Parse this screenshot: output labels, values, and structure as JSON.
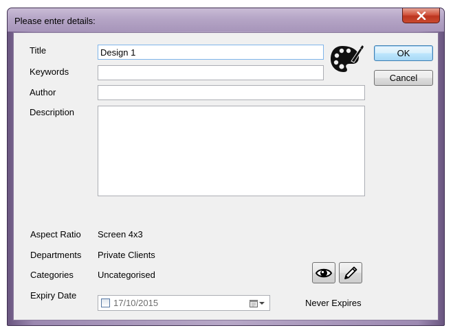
{
  "window": {
    "title": "Please enter details:",
    "close_label": "X"
  },
  "form": {
    "title_label": "Title",
    "title_value": "Design 1",
    "keywords_label": "Keywords",
    "keywords_value": "",
    "author_label": "Author",
    "author_value": "",
    "description_label": "Description",
    "description_value": "",
    "aspect_ratio_label": "Aspect Ratio",
    "aspect_ratio_value": "Screen 4x3",
    "departments_label": "Departments",
    "departments_value": "Private Clients",
    "categories_label": "Categories",
    "categories_value": "Uncategorised",
    "expiry_label": "Expiry Date",
    "expiry_value": "17/10/2015",
    "expiry_status": "Never Expires"
  },
  "buttons": {
    "ok_label": "OK",
    "cancel_label": "Cancel"
  },
  "icons": {
    "palette": "palette-icon",
    "view": "eye-icon",
    "edit": "pencil-icon",
    "calendar": "calendar-icon"
  }
}
